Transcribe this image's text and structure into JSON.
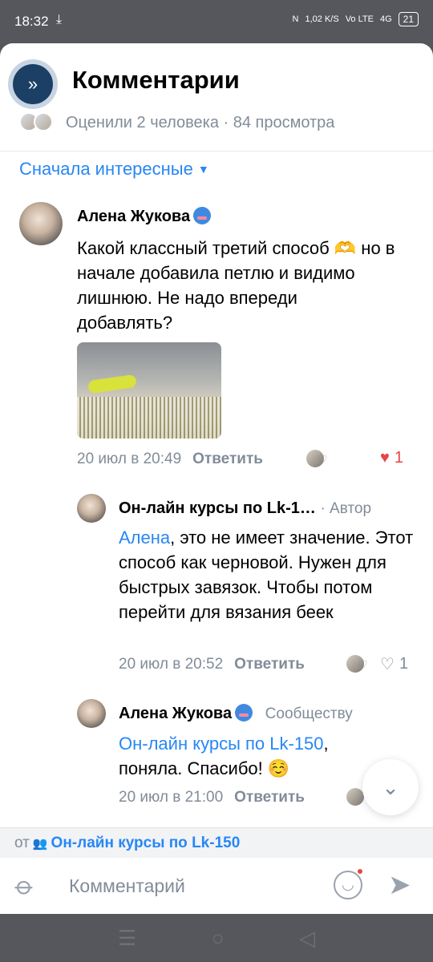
{
  "status": {
    "time": "18:32",
    "download_icon": "download-icon",
    "speed": "1,02 K/S",
    "network": "Vo LTE",
    "signal": "4G",
    "battery": "21"
  },
  "header": {
    "title": "Комментарии",
    "stats": "Оценили 2 человека · 84 просмотра",
    "collapse_icon": "double-chevron-right-icon"
  },
  "sort": {
    "label": "Сначала интересные"
  },
  "comments": [
    {
      "author": "Алена Жукова",
      "text": "Какой классный третий способ 🫶 но в начале добавила петлю и видимо лишнюю. Не надо впереди добавлять?",
      "time": "20 июл в 20:49",
      "reply": "Ответить",
      "likes": "1",
      "liked": true
    },
    {
      "author": "Он-лайн курсы по Lk-1…",
      "author_tag": "· Автор",
      "mention": "Алена",
      "text": ", это не имеет значение. Этот способ как черновой. Нужен для быстрых завязок. Чтобы потом перейти для вязания беек",
      "time": "20 июл в 20:52",
      "reply": "Ответить",
      "likes": "1",
      "liked": false
    },
    {
      "author": "Алена Жукова",
      "author_tag": "Сообществу",
      "mention": "Он-лайн курсы по Lk-150",
      "text": ", поняла. Спасибо! ☺️",
      "time": "20 июл в 21:00",
      "reply": "Ответить"
    }
  ],
  "composer": {
    "from_label": "от",
    "group": "Он-лайн курсы по Lk-150",
    "placeholder": "Комментарий"
  },
  "colors": {
    "accent": "#2787f5",
    "like": "#e64646",
    "secondary": "#818c99"
  }
}
